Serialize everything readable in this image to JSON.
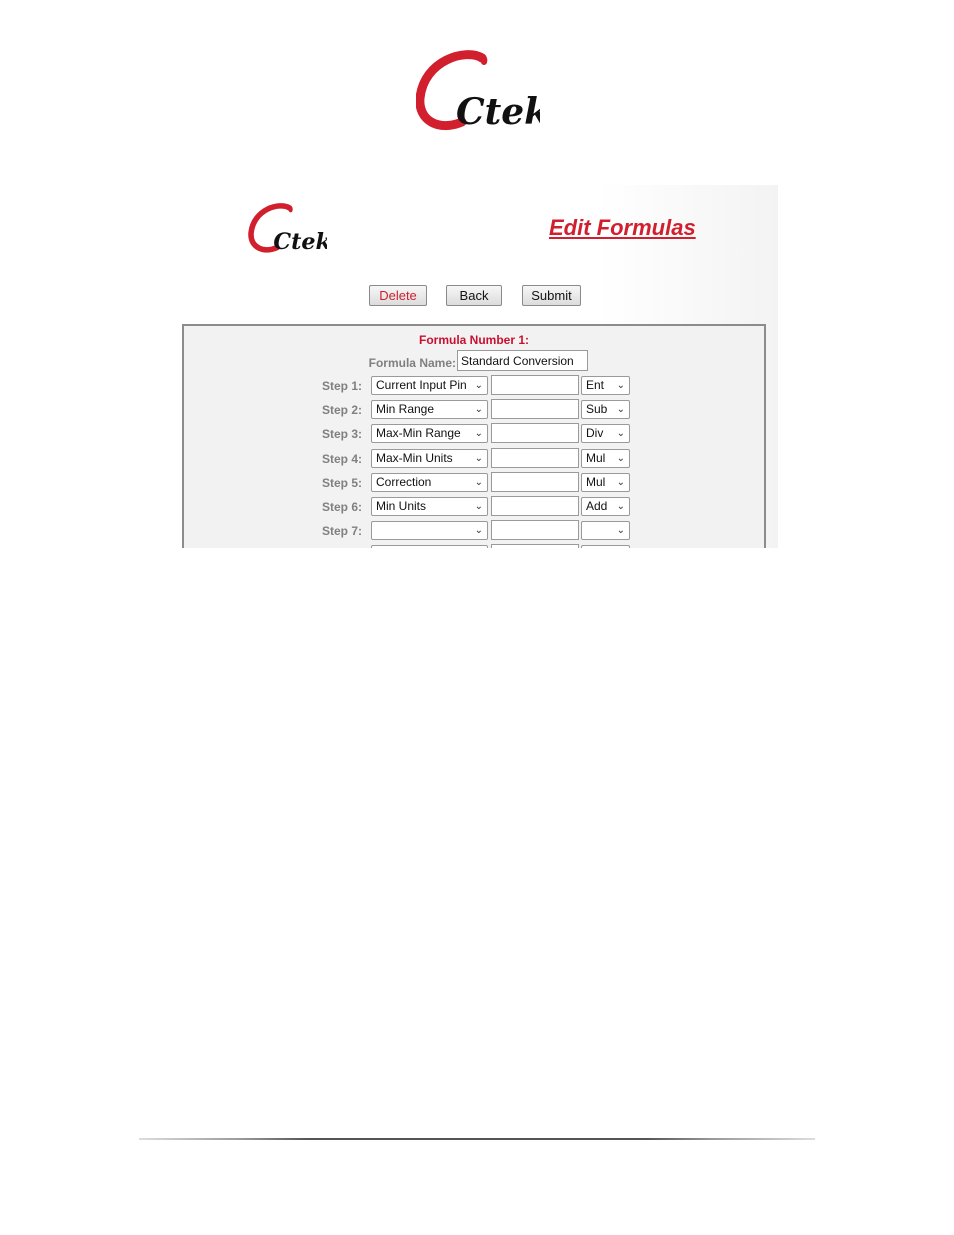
{
  "logo": {
    "text": "Ctek",
    "brand_color": "#d11f2e",
    "icon": "ctek-logo"
  },
  "page": {
    "title": "Edit Formulas",
    "title_color": "#d11f2e"
  },
  "buttons": {
    "delete": "Delete",
    "back": "Back",
    "submit": "Submit"
  },
  "form": {
    "number_label": "Formula Number 1:",
    "name_label": "Formula Name:",
    "name_value": "Standard Conversion",
    "steps": [
      {
        "label": "Step 1:",
        "source": "Current Input Pin",
        "value": "",
        "op": "Ent"
      },
      {
        "label": "Step 2:",
        "source": "Min Range",
        "value": "",
        "op": "Sub"
      },
      {
        "label": "Step 3:",
        "source": "Max-Min Range",
        "value": "",
        "op": "Div"
      },
      {
        "label": "Step 4:",
        "source": "Max-Min Units",
        "value": "",
        "op": "Mul"
      },
      {
        "label": "Step 5:",
        "source": "Correction",
        "value": "",
        "op": "Mul"
      },
      {
        "label": "Step 6:",
        "source": "Min Units",
        "value": "",
        "op": "Add"
      },
      {
        "label": "Step 7:",
        "source": "",
        "value": "",
        "op": ""
      }
    ]
  }
}
